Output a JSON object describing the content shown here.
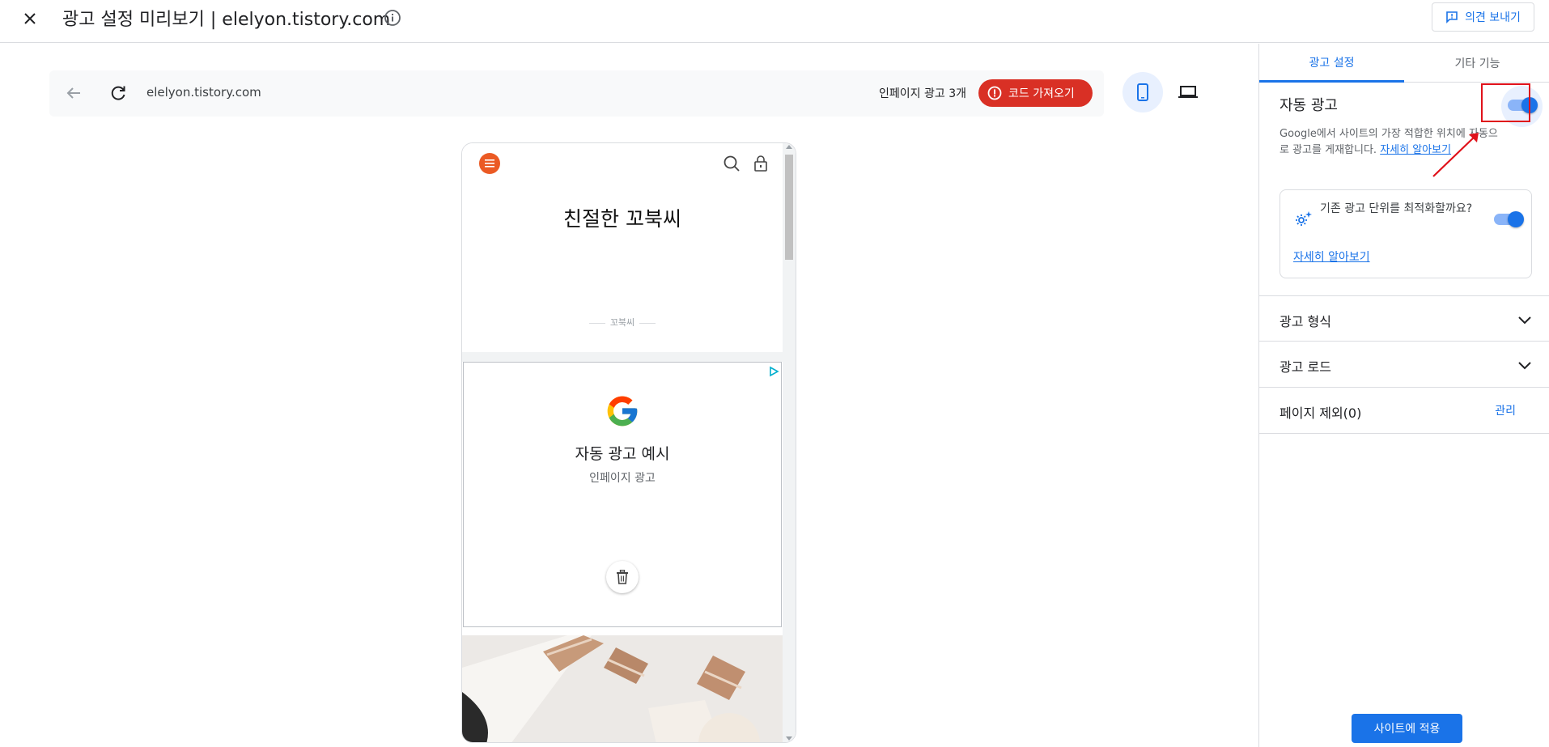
{
  "header": {
    "close_icon": "close-icon",
    "title": "광고 설정 미리보기 | elelyon.tistory.com",
    "info_icon": "info-icon",
    "feedback_label": "의견 보내기"
  },
  "preview": {
    "url": "elelyon.tistory.com",
    "inpage_ads": "인페이지 광고 3개",
    "get_code_label": "코드 가져오기",
    "device_selected": "mobile"
  },
  "blog": {
    "title": "친절한 꼬북씨",
    "subtitle": "꼬북씨"
  },
  "ad_sample": {
    "title": "자동 광고 예시",
    "subtitle": "인페이지 광고"
  },
  "panel": {
    "tabs": [
      {
        "label": "광고 설정",
        "active": true
      },
      {
        "label": "기타 기능",
        "active": false
      }
    ],
    "auto_ads": {
      "label": "자동 광고",
      "enabled": true,
      "description": "Google에서 사이트의 가장 적합한 위치에 자동으로 광고를 게재합니다.",
      "learn_more": "자세히 알아보기"
    },
    "optimize": {
      "text": "기존 광고 단위를 최적화할까요?",
      "enabled": true,
      "learn_more": "자세히 알아보기"
    },
    "sections": [
      {
        "label": "광고 형식"
      },
      {
        "label": "광고 로드"
      }
    ],
    "exclude": {
      "label": "페이지 제외(0)",
      "manage": "관리"
    },
    "apply_label": "사이트에 적용"
  },
  "colors": {
    "accent": "#1a73e8",
    "danger": "#d93025",
    "blog_accent": "#eb5a24"
  }
}
